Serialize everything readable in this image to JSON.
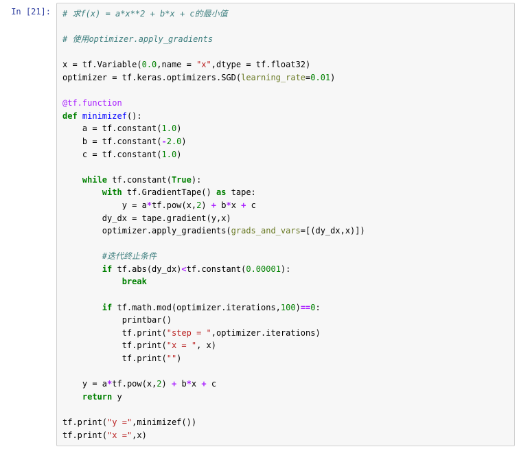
{
  "cell": {
    "prompt_label": "In [21]:",
    "code": {
      "l1_comment": "# 求f(x) = a*x**2 + b*x + c的最小值",
      "l3_comment": "# 使用optimizer.apply_gradients",
      "l5_x_assign_pre": "x = tf.Variable(",
      "l5_zero": "0.0",
      "l5_mid": ",name = ",
      "l5_str_x": "\"x\"",
      "l5_after_name": ",dtype = tf.float32)",
      "l6_opt_pre": "optimizer = tf.keras.optimizers.SGD(",
      "l6_arg": "learning_rate",
      "l6_eq": "=",
      "l6_val": "0.01",
      "l6_post": ")",
      "l8_at": "@tf.function",
      "l9_def": "def",
      "l9_fn": " minimizef",
      "l9_paren": "():",
      "l10_pre": "    a = tf.constant(",
      "l10_v": "1.0",
      "l10_post": ")",
      "l11_pre": "    b = tf.constant(",
      "l11_minus": "-",
      "l11_v": "2.0",
      "l11_post": ")",
      "l12_pre": "    c = tf.constant(",
      "l12_v": "1.0",
      "l12_post": ")",
      "l14_indent": "    ",
      "l14_while": "while",
      "l14_pre": " tf.constant(",
      "l14_true": "True",
      "l14_post": "):",
      "l15_indent": "        ",
      "l15_with": "with",
      "l15_mid": " tf.GradientTape() ",
      "l15_as": "as",
      "l15_tape": " tape:",
      "l16_pre": "            y = a",
      "l16_star1": "*",
      "l16_mid1": "tf.pow(x,",
      "l16_two": "2",
      "l16_mid2": ") ",
      "l16_plus1": "+",
      "l16_mid3": " b",
      "l16_star2": "*",
      "l16_mid4": "x ",
      "l16_plus2": "+",
      "l16_c": " c",
      "l17_txt": "        dy_dx = tape.gradient(y,x)",
      "l18_pre": "        optimizer.apply_gradients(",
      "l18_arg": "grads_and_vars",
      "l18_eq": "=",
      "l18_post": "[(dy_dx,x)])",
      "l20_comment": "        #迭代终止条件",
      "l21_indent": "        ",
      "l21_if": "if",
      "l21_pre": " tf.abs(dy_dx)",
      "l21_lt": "<",
      "l21_mid": "tf.constant(",
      "l21_v": "0.00001",
      "l21_post": "):",
      "l22_indent": "            ",
      "l22_break": "break",
      "l24_indent": "        ",
      "l24_if": "if",
      "l24_pre": " tf.math.mod(optimizer.iterations,",
      "l24_hundred": "100",
      "l24_mid": ")",
      "l24_eqeq": "==",
      "l24_zero": "0",
      "l24_post": ":",
      "l25_txt": "            printbar()",
      "l26_pre": "            tf.print(",
      "l26_str": "\"step = \"",
      "l26_post": ",optimizer.iterations)",
      "l27_pre": "            tf.print(",
      "l27_str": "\"x = \"",
      "l27_post": ", x)",
      "l28_pre": "            tf.print(",
      "l28_str": "\"\"",
      "l28_post": ")",
      "l30_pre": "    y = a",
      "l30_star1": "*",
      "l30_mid1": "tf.pow(x,",
      "l30_two": "2",
      "l30_mid2": ") ",
      "l30_plus1": "+",
      "l30_mid3": " b",
      "l30_star2": "*",
      "l30_mid4": "x ",
      "l30_plus2": "+",
      "l30_c": " c",
      "l31_indent": "    ",
      "l31_return": "return",
      "l31_y": " y",
      "l33_pre": "tf.print(",
      "l33_str": "\"y =\"",
      "l33_post": ",minimizef())",
      "l34_pre": "tf.print(",
      "l34_str": "\"x =\"",
      "l34_post": ",x)"
    }
  }
}
